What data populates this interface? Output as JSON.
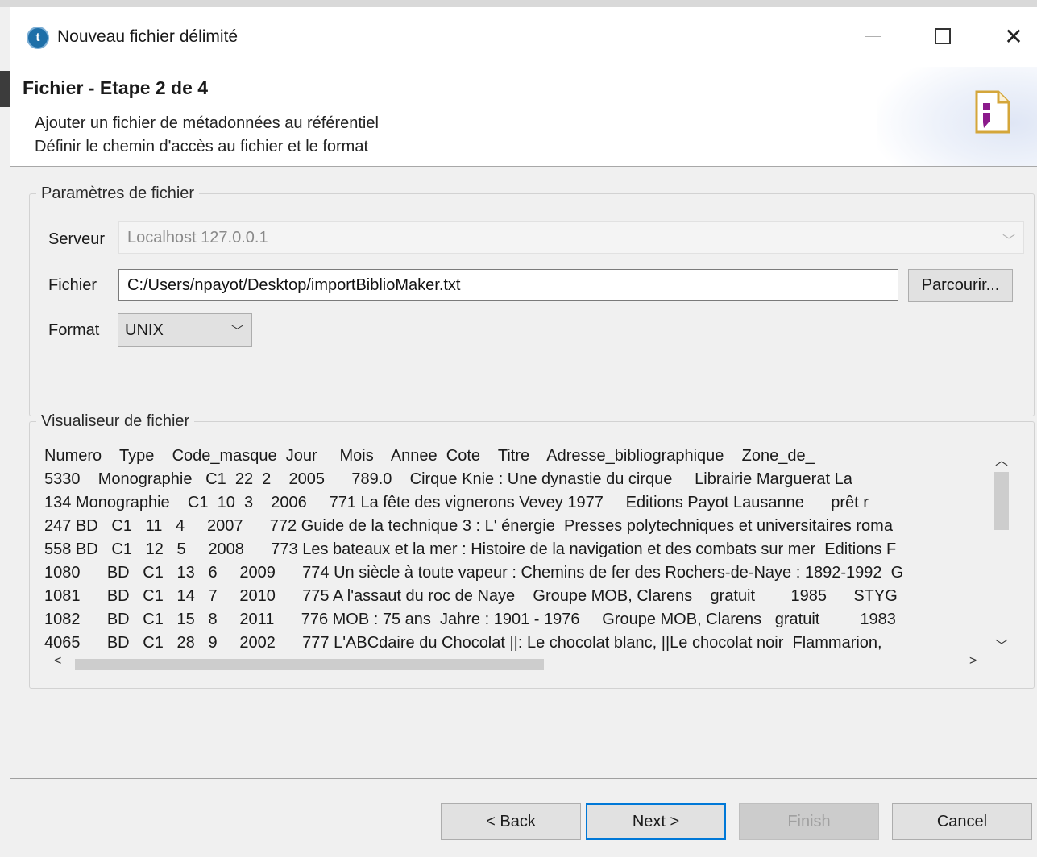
{
  "window": {
    "title": "Nouveau fichier délimité",
    "app_icon_glyph": "t"
  },
  "header": {
    "step_title": "Fichier - Etape 2 de 4",
    "description_line1": "Ajouter un fichier de métadonnées au référentiel",
    "description_line2": "Définir le chemin d'accès au fichier et le format"
  },
  "params": {
    "legend": "Paramètres de fichier",
    "server_label": "Serveur",
    "server_value": "Localhost 127.0.0.1",
    "file_label": "Fichier",
    "file_value": "C:/Users/npayot/Desktop/importBiblioMaker.txt",
    "browse_label": "Parcourir...",
    "format_label": "Format",
    "format_value": "UNIX"
  },
  "viewer": {
    "legend": "Visualiseur de fichier",
    "lines": [
      "Numero    Type    Code_masque  Jour     Mois    Annee  Cote    Titre    Adresse_bibliographique    Zone_de_",
      "5330    Monographie   C1  22  2    2005      789.0    Cirque Knie : Une dynastie du cirque     Librairie Marguerat La",
      "134 Monographie    C1  10  3    2006     771 La fête des vignerons Vevey 1977     Editions Payot Lausanne      prêt r",
      "247 BD   C1   11   4     2007      772 Guide de la technique 3 : L' énergie  Presses polytechniques et universitaires roma",
      "558 BD   C1   12   5     2008      773 Les bateaux et la mer : Histoire de la navigation et des combats sur mer  Editions F",
      "1080      BD   C1   13   6     2009      774 Un siècle à toute vapeur : Chemins de fer des Rochers-de-Naye : 1892-1992  G",
      "1081      BD   C1   14   7     2010      775 A l'assaut du roc de Naye    Groupe MOB, Clarens    gratuit        1985      STYG",
      "1082      BD   C1   15   8     2011      776 MOB : 75 ans  Jahre : 1901 - 1976     Groupe MOB, Clarens   gratuit         1983",
      "4065      BD   C1   28   9     2002      777 L'ABCdaire du Chocolat ||: Le chocolat blanc, ||Le chocolat noir  Flammarion,"
    ]
  },
  "buttons": {
    "back": "< Back",
    "next": "Next >",
    "finish": "Finish",
    "cancel": "Cancel"
  },
  "colors": {
    "focus_border": "#0078d7",
    "wizard_icon_accent": "#8b1a8b",
    "wizard_icon_frame": "#d4a63a"
  },
  "icons": {
    "app": "talend-icon",
    "wizard": "wizard-file-icon",
    "minimize": "minimize-icon",
    "maximize": "maximize-icon",
    "close": "close-icon"
  }
}
